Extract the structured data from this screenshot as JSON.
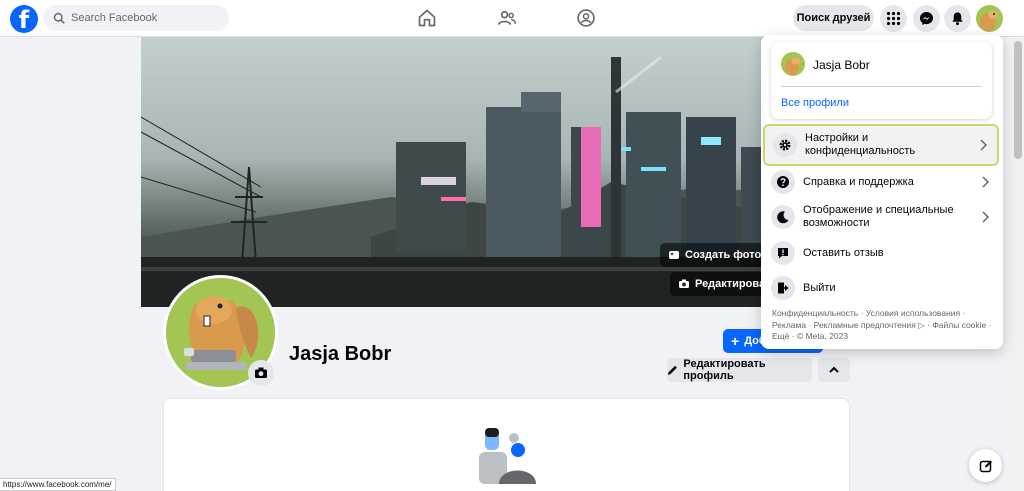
{
  "topbar": {
    "search_placeholder": "Search Facebook",
    "find_friends": "Поиск друзей"
  },
  "cover": {
    "create_cover_label": "Создать фото обложки",
    "edit_cover_label": "Редактировать фото обложки"
  },
  "profile": {
    "name": "Jasja Bobr",
    "add_story_label": "Добавить в историю",
    "edit_profile_label": "Редактировать профиль"
  },
  "menu": {
    "user_name": "Jasja Bobr",
    "all_profiles": "Все профили",
    "items": [
      {
        "label": "Настройки и конфиденциальность",
        "icon": "gear-icon"
      },
      {
        "label": "Справка и поддержка",
        "icon": "question-icon"
      },
      {
        "label": "Отображение и специальные возможности",
        "icon": "moon-icon"
      },
      {
        "label": "Оставить отзыв",
        "icon": "feedback-icon"
      },
      {
        "label": "Выйти",
        "icon": "logout-icon"
      }
    ],
    "footer": "Конфиденциальность · Условия использования · Реклама · Рекламные предпочтения ▷ · Файлы cookie · Ещё · © Meta, 2023"
  },
  "status_url": "https://www.facebook.com/me/",
  "colors": {
    "brand": "#0866ff",
    "highlight_border": "#cbd66b",
    "avatar_bg": "#a3c553"
  }
}
